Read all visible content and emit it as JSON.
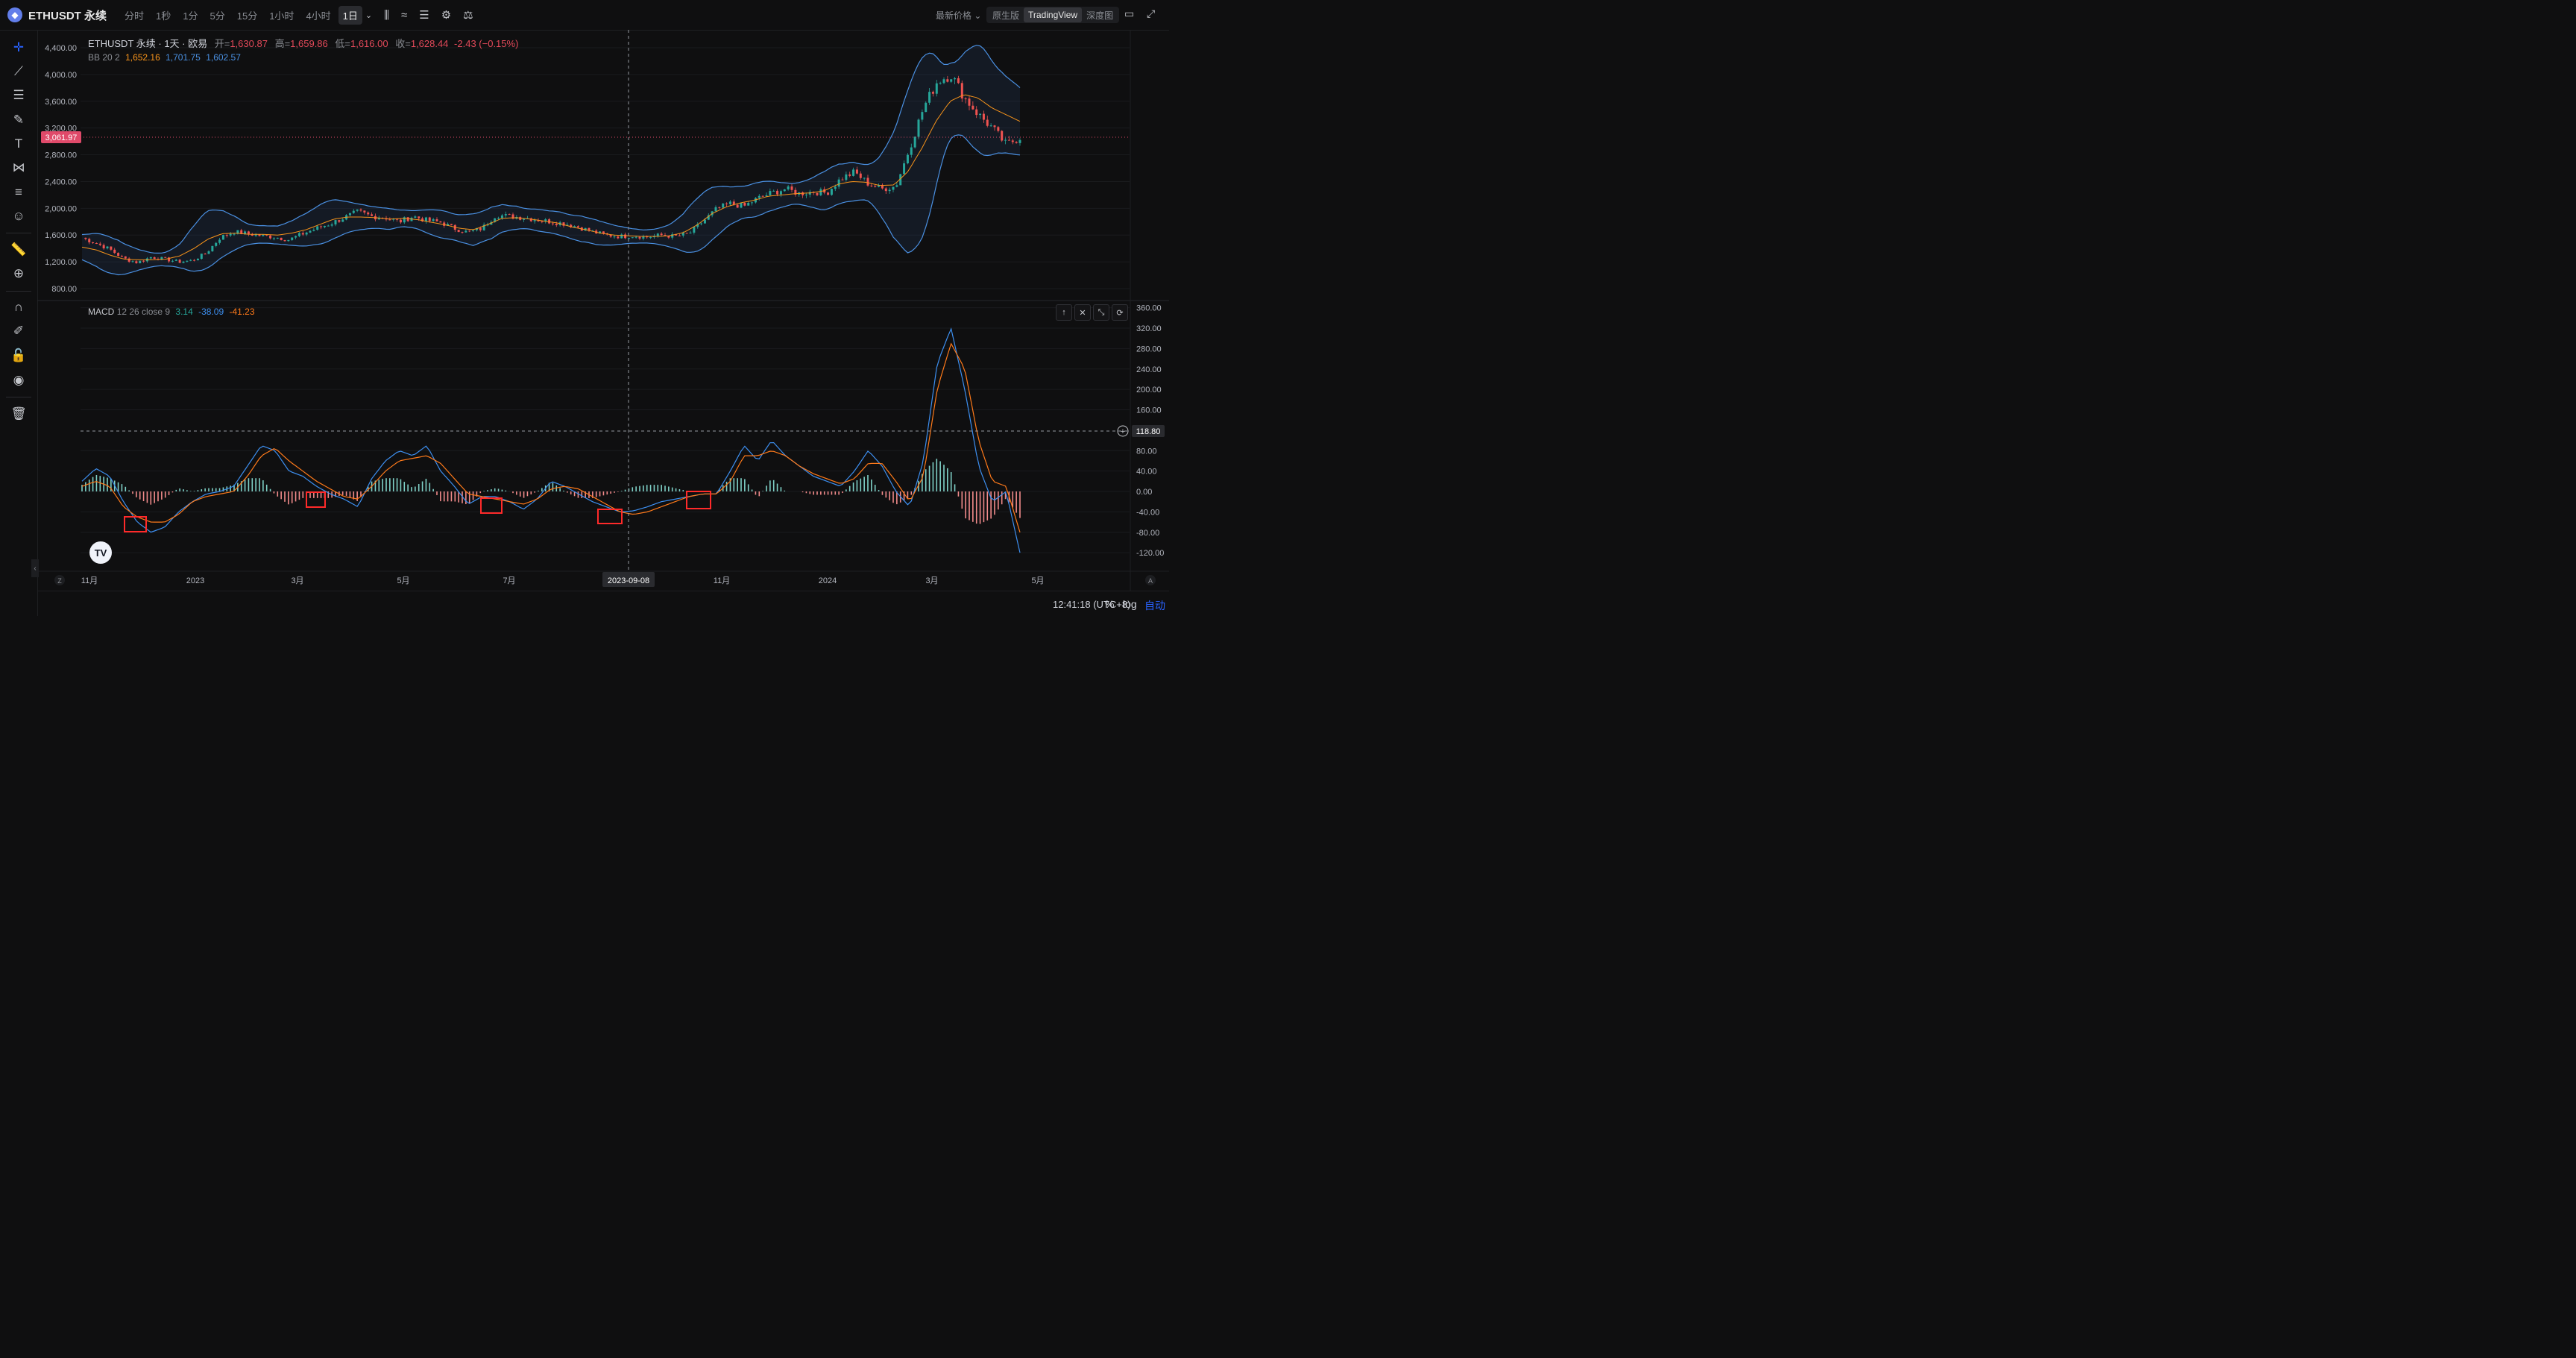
{
  "topbar": {
    "coin_icon": "ethereum-icon",
    "symbol": "ETHUSDT 永续",
    "intervals": [
      "分时",
      "1秒",
      "1分",
      "5分",
      "15分",
      "1小时",
      "4小时",
      "1日"
    ],
    "active_interval": "1日",
    "price_type": "最新价格",
    "views": [
      "原生版",
      "TradingView",
      "深度图"
    ],
    "active_view": "TradingView"
  },
  "legend": {
    "title": "ETHUSDT 永续 · 1天 · 欧易",
    "open_label": "开=",
    "open": "1,630.87",
    "high_label": "高=",
    "high": "1,659.86",
    "low_label": "低=",
    "low": "1,616.00",
    "close_label": "收=",
    "close": "1,628.44",
    "change": "-2.43 (−0.15%)"
  },
  "bb": {
    "label": "BB",
    "params": "20 2",
    "basis": "1,652.16",
    "upper": "1,701.75",
    "lower": "1,602.57"
  },
  "macd": {
    "label": "MACD",
    "params": "12 26 close 9",
    "hist": "3.14",
    "macd": "-38.09",
    "signal": "-41.23"
  },
  "price_axis": {
    "ticks": [
      "4,400.00",
      "4,000.00",
      "3,600.00",
      "3,200.00",
      "2,800.00",
      "2,400.00",
      "2,000.00",
      "1,600.00",
      "1,200.00",
      "800.00"
    ],
    "current_price": "3,061.97"
  },
  "macd_axis": {
    "ticks": [
      "360.00",
      "320.00",
      "280.00",
      "240.00",
      "200.00",
      "160.00",
      "80.00",
      "40.00",
      "0.00",
      "-40.00",
      "-80.00",
      "-120.00"
    ],
    "crosshair_value": "118.80"
  },
  "time_axis": {
    "ticks": [
      "11月",
      "2023",
      "3月",
      "5月",
      "7月",
      "11月",
      "2024",
      "3月",
      "5月"
    ],
    "crosshair_date": "2023-09-08"
  },
  "bottom": {
    "time": "12:41:18 (UTC+8)",
    "percent": "%",
    "log": "log",
    "auto": "自动"
  },
  "colors": {
    "up": "#26a69a",
    "down": "#ef5350",
    "bb_basis": "#f7931a",
    "bb_band": "#4a90e2",
    "macd_line": "#3d8ff0",
    "signal_line": "#ff7a1a",
    "highlight_box": "#ff2a2a",
    "price_tag": "#e04a6a"
  },
  "chart_data": {
    "type": "candlestick",
    "symbol": "ETHUSDT",
    "ylim": [
      800,
      4400
    ],
    "macd_ylim": [
      -120,
      360
    ],
    "date_range": [
      "2022-11",
      "2024-04"
    ],
    "close_path": [
      1560,
      1480,
      1390,
      1250,
      1190,
      1270,
      1240,
      1200,
      1220,
      1330,
      1560,
      1650,
      1620,
      1590,
      1570,
      1530,
      1620,
      1700,
      1770,
      1860,
      1950,
      1880,
      1860,
      1800,
      1880,
      1820,
      1790,
      1700,
      1640,
      1700,
      1900,
      1880,
      1860,
      1830,
      1800,
      1770,
      1720,
      1650,
      1600,
      1580,
      1590,
      1570,
      1600,
      1580,
      1620,
      1800,
      1990,
      2070,
      2030,
      2150,
      2230,
      2290,
      2220,
      2250,
      2230,
      2440,
      2540,
      2370,
      2290,
      2330,
      2900,
      3500,
      3900,
      4000,
      3650,
      3400,
      3200,
      2950,
      3060
    ],
    "bb_basis_path": [
      1420,
      1380,
      1300,
      1240,
      1230,
      1230,
      1240,
      1290,
      1400,
      1540,
      1620,
      1630,
      1610,
      1610,
      1600,
      1630,
      1680,
      1760,
      1840,
      1870,
      1870,
      1860,
      1840,
      1850,
      1830,
      1790,
      1750,
      1700,
      1680,
      1760,
      1850,
      1860,
      1840,
      1810,
      1780,
      1720,
      1680,
      1630,
      1600,
      1590,
      1580,
      1580,
      1590,
      1640,
      1760,
      1920,
      2020,
      2080,
      2120,
      2180,
      2200,
      2220,
      2230,
      2260,
      2360,
      2400,
      2390,
      2340,
      2350,
      2550,
      2900,
      3300,
      3600,
      3700,
      3650,
      3500,
      3400,
      3300
    ],
    "macd_line_path": [
      20,
      45,
      30,
      -20,
      -60,
      -80,
      -70,
      -40,
      -20,
      -5,
      0,
      10,
      50,
      90,
      80,
      40,
      30,
      10,
      -5,
      -15,
      -30,
      25,
      60,
      80,
      70,
      90,
      40,
      10,
      -25,
      -10,
      -10,
      -20,
      -35,
      -15,
      20,
      10,
      -5,
      -20,
      -30,
      -40,
      -38,
      -30,
      -20,
      -15,
      -10,
      -5,
      -5,
      40,
      90,
      60,
      100,
      70,
      50,
      30,
      20,
      10,
      40,
      80,
      50,
      0,
      -30,
      60,
      250,
      320,
      200,
      50,
      -20,
      0,
      -120
    ],
    "signal_line_path": [
      10,
      20,
      10,
      -30,
      -50,
      -60,
      -60,
      -45,
      -20,
      -10,
      -5,
      0,
      30,
      70,
      85,
      60,
      40,
      20,
      5,
      -10,
      -15,
      10,
      40,
      60,
      65,
      70,
      55,
      25,
      -5,
      -10,
      -15,
      -20,
      -25,
      -15,
      5,
      10,
      5,
      -10,
      -25,
      -40,
      -45,
      -40,
      -30,
      -20,
      -10,
      -5,
      -5,
      20,
      70,
      70,
      80,
      70,
      50,
      35,
      25,
      15,
      25,
      55,
      55,
      20,
      -20,
      30,
      200,
      290,
      240,
      100,
      20,
      10,
      -80
    ],
    "highlighted_troughs": [
      "2022-12",
      "2023-03",
      "2023-06",
      "2023-08",
      "2023-10"
    ]
  }
}
